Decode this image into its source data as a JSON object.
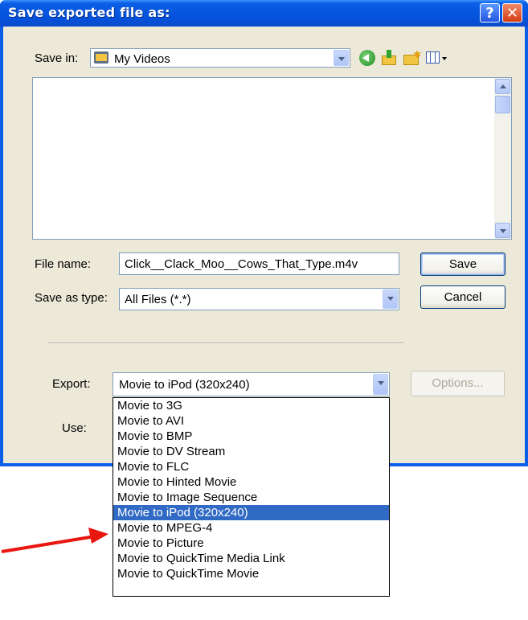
{
  "dialog": {
    "title": "Save exported file as:",
    "help_glyph": "?",
    "close_glyph": "✕"
  },
  "save_in": {
    "label": "Save in:",
    "value": "My Videos"
  },
  "file_name": {
    "label": "File name:",
    "value": "Click__Clack_Moo__Cows_That_Type.m4v"
  },
  "save_as_type": {
    "label": "Save as type:",
    "value": "All Files (*.*)"
  },
  "buttons": {
    "save": "Save",
    "cancel": "Cancel",
    "options": "Options..."
  },
  "export": {
    "label": "Export:",
    "value": "Movie to iPod (320x240)",
    "options": [
      "Movie to 3G",
      "Movie to AVI",
      "Movie to BMP",
      "Movie to DV Stream",
      "Movie to FLC",
      "Movie to Hinted Movie",
      "Movie to Image Sequence",
      "Movie to iPod (320x240)",
      "Movie to MPEG-4",
      "Movie to Picture",
      "Movie to QuickTime Media Link",
      "Movie to QuickTime Movie"
    ],
    "selected_index": 7
  },
  "use": {
    "label": "Use:"
  },
  "annotation": {
    "arrow_color": "#e8170f"
  }
}
